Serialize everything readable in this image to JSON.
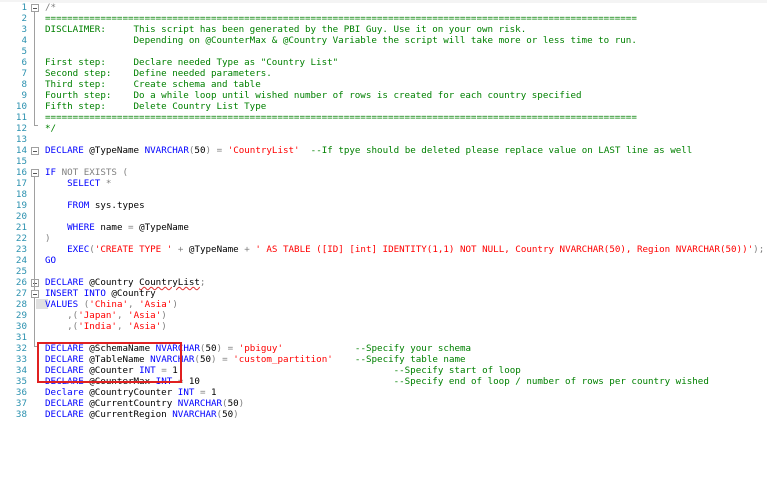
{
  "colors": {
    "line_number": "#2b91af",
    "keyword": "#0000ff",
    "operator": "#808080",
    "string": "#ff0000",
    "comment": "#008000",
    "function": "#ff00ff",
    "highlight_box": "#e02020"
  },
  "lines": [
    {
      "n": "1",
      "fold": "start",
      "tokens": [
        {
          "c": "gr",
          "t": "/*"
        }
      ]
    },
    {
      "n": "2",
      "tokens": [
        {
          "c": "cm",
          "t": "==========================================================================================================="
        }
      ]
    },
    {
      "n": "3",
      "tokens": [
        {
          "c": "cm",
          "t": "DISCLAIMER:     This script has been generated by the PBI Guy. Use it on your own risk."
        }
      ]
    },
    {
      "n": "4",
      "tokens": [
        {
          "c": "cm",
          "t": "                Depending on @CounterMax & @Country Variable the script will take more or less time to run."
        }
      ]
    },
    {
      "n": "5",
      "tokens": []
    },
    {
      "n": "6",
      "tokens": [
        {
          "c": "cm",
          "t": "First step:     Declare needed Type as \"Country List\""
        }
      ]
    },
    {
      "n": "7",
      "tokens": [
        {
          "c": "cm",
          "t": "Second step:    Define needed parameters."
        }
      ]
    },
    {
      "n": "8",
      "tokens": [
        {
          "c": "cm",
          "t": "Third step:     Create schema and table"
        }
      ]
    },
    {
      "n": "9",
      "tokens": [
        {
          "c": "cm",
          "t": "Fourth step:    Do a while loop until wished number of rows is created for each country specified"
        }
      ]
    },
    {
      "n": "10",
      "tokens": [
        {
          "c": "cm",
          "t": "Fifth step:     Delete Country List Type"
        }
      ]
    },
    {
      "n": "11",
      "tokens": [
        {
          "c": "cm",
          "t": "==========================================================================================================="
        }
      ]
    },
    {
      "n": "12",
      "tokens": [
        {
          "c": "cm",
          "t": "*/"
        }
      ]
    },
    {
      "n": "13",
      "tokens": []
    },
    {
      "n": "14",
      "fold": "start",
      "tokens": [
        {
          "c": "kw",
          "t": "DECLARE"
        },
        {
          "c": "tx",
          "t": " @TypeName "
        },
        {
          "c": "kw",
          "t": "NVARCHAR"
        },
        {
          "c": "gr",
          "t": "("
        },
        {
          "c": "tx",
          "t": "50"
        },
        {
          "c": "gr",
          "t": ")"
        },
        {
          "c": "tx",
          "t": " "
        },
        {
          "c": "gr",
          "t": "="
        },
        {
          "c": "tx",
          "t": " "
        },
        {
          "c": "str",
          "t": "'CountryList'"
        },
        {
          "c": "tx",
          "t": "  "
        },
        {
          "c": "cm",
          "t": "--If tpye should be deleted please replace value on LAST line as well"
        }
      ]
    },
    {
      "n": "15",
      "tokens": []
    },
    {
      "n": "16",
      "fold": "start",
      "tokens": [
        {
          "c": "kw",
          "t": "IF"
        },
        {
          "c": "tx",
          "t": " "
        },
        {
          "c": "gr",
          "t": "NOT EXISTS ("
        }
      ]
    },
    {
      "n": "17",
      "tokens": [
        {
          "c": "tx",
          "t": "    "
        },
        {
          "c": "kw",
          "t": "SELECT"
        },
        {
          "c": "tx",
          "t": " "
        },
        {
          "c": "gr",
          "t": "*"
        }
      ]
    },
    {
      "n": "18",
      "tokens": []
    },
    {
      "n": "19",
      "tokens": [
        {
          "c": "tx",
          "t": "    "
        },
        {
          "c": "kw",
          "t": "FROM"
        },
        {
          "c": "tx",
          "t": " "
        },
        {
          "c": "tx",
          "t": "sys.types"
        }
      ]
    },
    {
      "n": "20",
      "tokens": []
    },
    {
      "n": "21",
      "tokens": [
        {
          "c": "tx",
          "t": "    "
        },
        {
          "c": "kw",
          "t": "WHERE"
        },
        {
          "c": "tx",
          "t": " name "
        },
        {
          "c": "gr",
          "t": "="
        },
        {
          "c": "tx",
          "t": " @TypeName"
        }
      ]
    },
    {
      "n": "22",
      "tokens": [
        {
          "c": "gr",
          "t": ")"
        }
      ]
    },
    {
      "n": "23",
      "tokens": [
        {
          "c": "tx",
          "t": "    "
        },
        {
          "c": "kw",
          "t": "EXEC"
        },
        {
          "c": "gr",
          "t": "("
        },
        {
          "c": "str",
          "t": "'CREATE TYPE '"
        },
        {
          "c": "tx",
          "t": " "
        },
        {
          "c": "gr",
          "t": "+"
        },
        {
          "c": "tx",
          "t": " @TypeName "
        },
        {
          "c": "gr",
          "t": "+"
        },
        {
          "c": "tx",
          "t": " "
        },
        {
          "c": "str",
          "t": "' AS TABLE ([ID] [int] IDENTITY(1,1) NOT NULL, Country NVARCHAR(50), Region NVARCHAR(50))'"
        },
        {
          "c": "gr",
          "t": ");"
        }
      ]
    },
    {
      "n": "24",
      "tokens": [
        {
          "c": "kw",
          "t": "GO"
        }
      ]
    },
    {
      "n": "25",
      "tokens": []
    },
    {
      "n": "26",
      "fold": "start",
      "tokens": [
        {
          "c": "kw",
          "t": "DECLARE"
        },
        {
          "c": "tx",
          "t": " @Country "
        },
        {
          "c": "und",
          "t": "CountryList"
        },
        {
          "c": "gr",
          "t": ";"
        }
      ]
    },
    {
      "n": "27",
      "fold": "start",
      "tokens": [
        {
          "c": "kw",
          "t": "INSERT INTO"
        },
        {
          "c": "tx",
          "t": " @Country"
        }
      ]
    },
    {
      "n": "28",
      "hl": true,
      "tokens": [
        {
          "c": "kw",
          "t": "VALUES"
        },
        {
          "c": "tx",
          "t": " "
        },
        {
          "c": "gr",
          "t": "("
        },
        {
          "c": "str",
          "t": "'China'"
        },
        {
          "c": "gr",
          "t": ","
        },
        {
          "c": "tx",
          "t": " "
        },
        {
          "c": "str",
          "t": "'Asia'"
        },
        {
          "c": "gr",
          "t": ")"
        }
      ]
    },
    {
      "n": "29",
      "tokens": [
        {
          "c": "tx",
          "t": "    "
        },
        {
          "c": "gr",
          "t": ",("
        },
        {
          "c": "str",
          "t": "'Japan'"
        },
        {
          "c": "gr",
          "t": ","
        },
        {
          "c": "tx",
          "t": " "
        },
        {
          "c": "str",
          "t": "'Asia'"
        },
        {
          "c": "gr",
          "t": ")"
        }
      ]
    },
    {
      "n": "30",
      "tokens": [
        {
          "c": "tx",
          "t": "    "
        },
        {
          "c": "gr",
          "t": ",("
        },
        {
          "c": "str",
          "t": "'India'"
        },
        {
          "c": "gr",
          "t": ","
        },
        {
          "c": "tx",
          "t": " "
        },
        {
          "c": "str",
          "t": "'Asia'"
        },
        {
          "c": "gr",
          "t": ")"
        }
      ]
    },
    {
      "n": "31",
      "tokens": []
    },
    {
      "n": "32",
      "tokens": [
        {
          "c": "kw",
          "t": "DECLARE"
        },
        {
          "c": "tx",
          "t": " @SchemaName "
        },
        {
          "c": "kw",
          "t": "NVARCHAR"
        },
        {
          "c": "gr",
          "t": "("
        },
        {
          "c": "tx",
          "t": "50"
        },
        {
          "c": "gr",
          "t": ")"
        },
        {
          "c": "tx",
          "t": " "
        },
        {
          "c": "gr",
          "t": "="
        },
        {
          "c": "tx",
          "t": " "
        },
        {
          "c": "str",
          "t": "'pbiguy'"
        },
        {
          "c": "tx",
          "t": "             "
        },
        {
          "c": "cm",
          "t": "--Specify your schema"
        }
      ]
    },
    {
      "n": "33",
      "tokens": [
        {
          "c": "kw",
          "t": "DECLARE"
        },
        {
          "c": "tx",
          "t": " @TableName "
        },
        {
          "c": "kw",
          "t": "NVARCHAR"
        },
        {
          "c": "gr",
          "t": "("
        },
        {
          "c": "tx",
          "t": "50"
        },
        {
          "c": "gr",
          "t": ")"
        },
        {
          "c": "tx",
          "t": " "
        },
        {
          "c": "gr",
          "t": "="
        },
        {
          "c": "tx",
          "t": " "
        },
        {
          "c": "str",
          "t": "'custom_partition'"
        },
        {
          "c": "tx",
          "t": "    "
        },
        {
          "c": "cm",
          "t": "--Specify table name"
        }
      ]
    },
    {
      "n": "34",
      "tokens": [
        {
          "c": "kw",
          "t": "DECLARE"
        },
        {
          "c": "tx",
          "t": " @Counter "
        },
        {
          "c": "kw",
          "t": "INT"
        },
        {
          "c": "tx",
          "t": " "
        },
        {
          "c": "gr",
          "t": "="
        },
        {
          "c": "tx",
          "t": " 1                                       "
        },
        {
          "c": "cm",
          "t": "--Specify start of loop"
        }
      ]
    },
    {
      "n": "35",
      "tokens": [
        {
          "c": "kw",
          "t": "DECLARE"
        },
        {
          "c": "tx",
          "t": " @CounterMax "
        },
        {
          "c": "kw",
          "t": "INT"
        },
        {
          "c": "tx",
          "t": " "
        },
        {
          "c": "gr",
          "t": "="
        },
        {
          "c": "tx",
          "t": " 10                                   "
        },
        {
          "c": "cm",
          "t": "--Specify end of loop / number of rows per country wished"
        }
      ]
    },
    {
      "n": "36",
      "tokens": [
        {
          "c": "kw",
          "t": "Declare"
        },
        {
          "c": "tx",
          "t": " @CountryCounter "
        },
        {
          "c": "kw",
          "t": "INT"
        },
        {
          "c": "tx",
          "t": " "
        },
        {
          "c": "gr",
          "t": "="
        },
        {
          "c": "tx",
          "t": " 1"
        }
      ]
    },
    {
      "n": "37",
      "tokens": [
        {
          "c": "kw",
          "t": "DECLARE"
        },
        {
          "c": "tx",
          "t": " @CurrentCountry "
        },
        {
          "c": "kw",
          "t": "NVARCHAR"
        },
        {
          "c": "gr",
          "t": "("
        },
        {
          "c": "tx",
          "t": "50"
        },
        {
          "c": "gr",
          "t": ")"
        }
      ]
    },
    {
      "n": "38",
      "tokens": [
        {
          "c": "kw",
          "t": "DECLARE"
        },
        {
          "c": "tx",
          "t": " @CurrentRegion "
        },
        {
          "c": "kw",
          "t": "NVARCHAR"
        },
        {
          "c": "gr",
          "t": "("
        },
        {
          "c": "tx",
          "t": "50"
        },
        {
          "c": "gr",
          "t": ")"
        }
      ]
    }
  ]
}
